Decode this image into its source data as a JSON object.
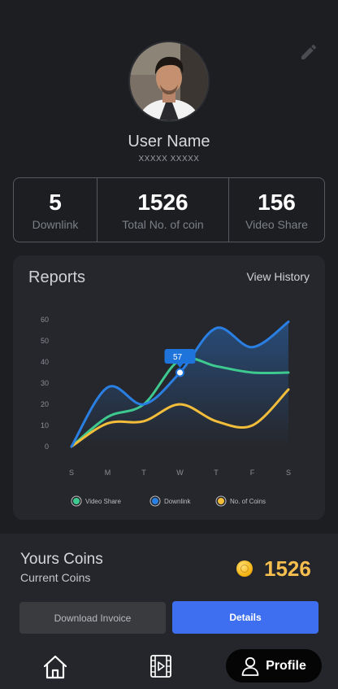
{
  "profile": {
    "name": "User Name",
    "subtitle": "XXXXX XXXXX"
  },
  "stats": [
    {
      "value": "5",
      "label": "Downlink"
    },
    {
      "value": "1526",
      "label": "Total No. of coin"
    },
    {
      "value": "156",
      "label": "Video Share"
    }
  ],
  "reports": {
    "title": "Reports",
    "view_history": "View History"
  },
  "chart_data": {
    "type": "line",
    "categories": [
      "S",
      "M",
      "T",
      "W",
      "T",
      "F",
      "S"
    ],
    "y_ticks": [
      0,
      10,
      20,
      30,
      40,
      50,
      60
    ],
    "ylim": [
      0,
      60
    ],
    "grid": false,
    "legend": "bottom",
    "series": [
      {
        "name": "Video Share",
        "color": "#3ec98f",
        "values": [
          0,
          14,
          20,
          41,
          38,
          35,
          35
        ]
      },
      {
        "name": "Downlink",
        "color": "#2a7fe3",
        "values": [
          0,
          28,
          20,
          35,
          56,
          47,
          59
        ]
      },
      {
        "name": "No. of Coins",
        "color": "#f2bd3a",
        "values": [
          0,
          11,
          12,
          20,
          12,
          10,
          27
        ]
      }
    ],
    "tooltip": {
      "series": "Downlink",
      "category_index": 3,
      "label": "57"
    }
  },
  "coins": {
    "title": "Yours Coins",
    "subtitle": "Current Coins",
    "value": "1526",
    "download_label": "Download Invoice",
    "details_label": "Details"
  },
  "nav": {
    "profile_label": "Profile"
  },
  "icons": {
    "edit": "pencil-icon",
    "coin": "coin-icon",
    "home": "home-icon",
    "video": "film-icon",
    "profile": "user-icon"
  }
}
